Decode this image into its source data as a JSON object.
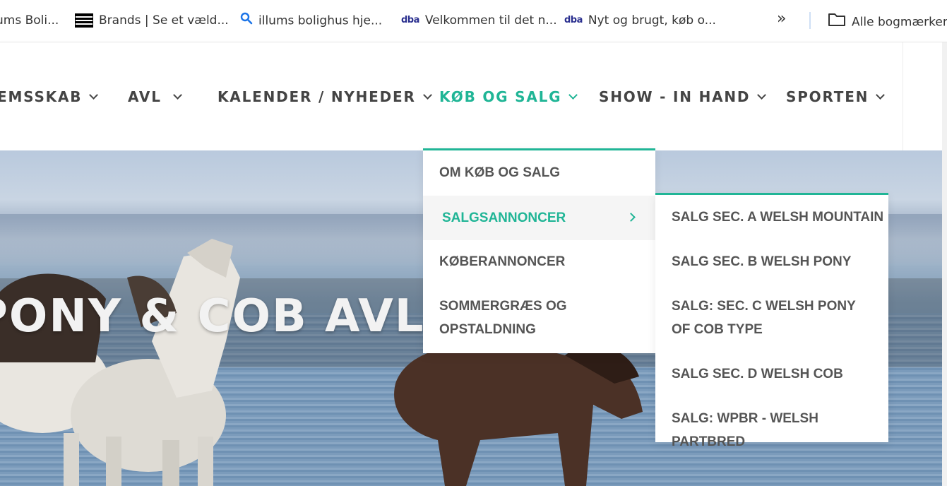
{
  "bookmarks": [
    {
      "label": "ums Boli...",
      "icon": "none"
    },
    {
      "label": "Brands | Se et væld...",
      "icon": "flag-icon"
    },
    {
      "label": "illums bolighus hje...",
      "icon": "search-icon"
    },
    {
      "label": "Velkommen til det n...",
      "icon": "dba-icon",
      "icon_text": "dba"
    },
    {
      "label": "Nyt og brugt, køb o...",
      "icon": "dba-icon",
      "icon_text": "dba"
    }
  ],
  "bookmarks_overflow": "»",
  "all_bookmarks_label": "Alle bogmærker",
  "nav": [
    {
      "label": "EMSSKAB",
      "active": false
    },
    {
      "label": "AVL",
      "active": false
    },
    {
      "label": "KALENDER / NYHEDER",
      "active": false
    },
    {
      "label": "KØB OG SALG",
      "active": true
    },
    {
      "label": "SHOW - IN HAND",
      "active": false
    },
    {
      "label": "SPORTEN",
      "active": false
    }
  ],
  "hero": {
    "title": "PONY & COB AVLER"
  },
  "dropdown": {
    "items": [
      {
        "label": "OM KØB OG SALG"
      },
      {
        "label": "SALGSANNONCER",
        "active": true,
        "has_submenu": true
      },
      {
        "label": "KØBERANNONCER"
      },
      {
        "label": "SOMMERGRÆS OG OPSTALDNING"
      }
    ]
  },
  "submenu": {
    "items": [
      {
        "label": "SALG SEC. A WELSH MOUNTAIN"
      },
      {
        "label": "SALG SEC. B WELSH PONY"
      },
      {
        "label": "SALG: SEC. C WELSH PONY OF COB TYPE"
      },
      {
        "label": "SALG SEC. D WELSH COB"
      },
      {
        "label": "SALG: WPBR - WELSH PARTBRED"
      }
    ]
  },
  "colors": {
    "accent": "#20b596",
    "nav_text": "#444444",
    "menu_text": "#555555"
  }
}
